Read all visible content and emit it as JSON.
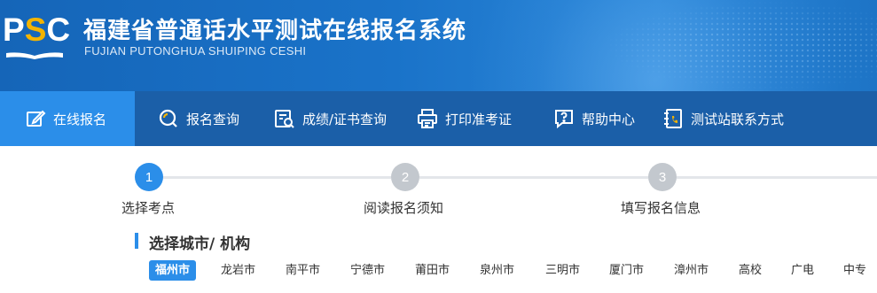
{
  "header": {
    "logo": {
      "text_p": "P",
      "text_s": "S",
      "text_c": "C"
    },
    "title": "福建省普通话水平测试在线报名系统",
    "subtitle": "FUJIAN PUTONGHUA SHUIPING CESHI"
  },
  "nav": {
    "items": [
      {
        "label": "在线报名",
        "icon": "edit-icon",
        "active": true
      },
      {
        "label": "报名查询",
        "icon": "search-icon",
        "active": false
      },
      {
        "label": "成绩/证书查询",
        "icon": "certificate-search-icon",
        "active": false
      },
      {
        "label": "打印准考证",
        "icon": "printer-icon",
        "active": false
      },
      {
        "label": "帮助中心",
        "icon": "help-chat-icon",
        "active": false
      },
      {
        "label": "测试站联系方式",
        "icon": "contact-book-icon",
        "active": false
      }
    ]
  },
  "steps": [
    {
      "number": "1",
      "label": "选择考点",
      "state": "active"
    },
    {
      "number": "2",
      "label": "阅读报名须知",
      "state": "todo"
    },
    {
      "number": "3",
      "label": "填写报名信息",
      "state": "todo"
    }
  ],
  "section": {
    "title": "选择城市/ 机构"
  },
  "cities": {
    "selected": "福州市",
    "items": [
      "福州市",
      "龙岩市",
      "南平市",
      "宁德市",
      "莆田市",
      "泉州市",
      "三明市",
      "厦门市",
      "漳州市",
      "高校",
      "广电",
      "中专"
    ]
  },
  "colors": {
    "accent": "#2b8ee9",
    "nav_bg": "#1b5fa8",
    "logo_yellow": "#f4b400",
    "step_todo": "#c3c8ce"
  }
}
